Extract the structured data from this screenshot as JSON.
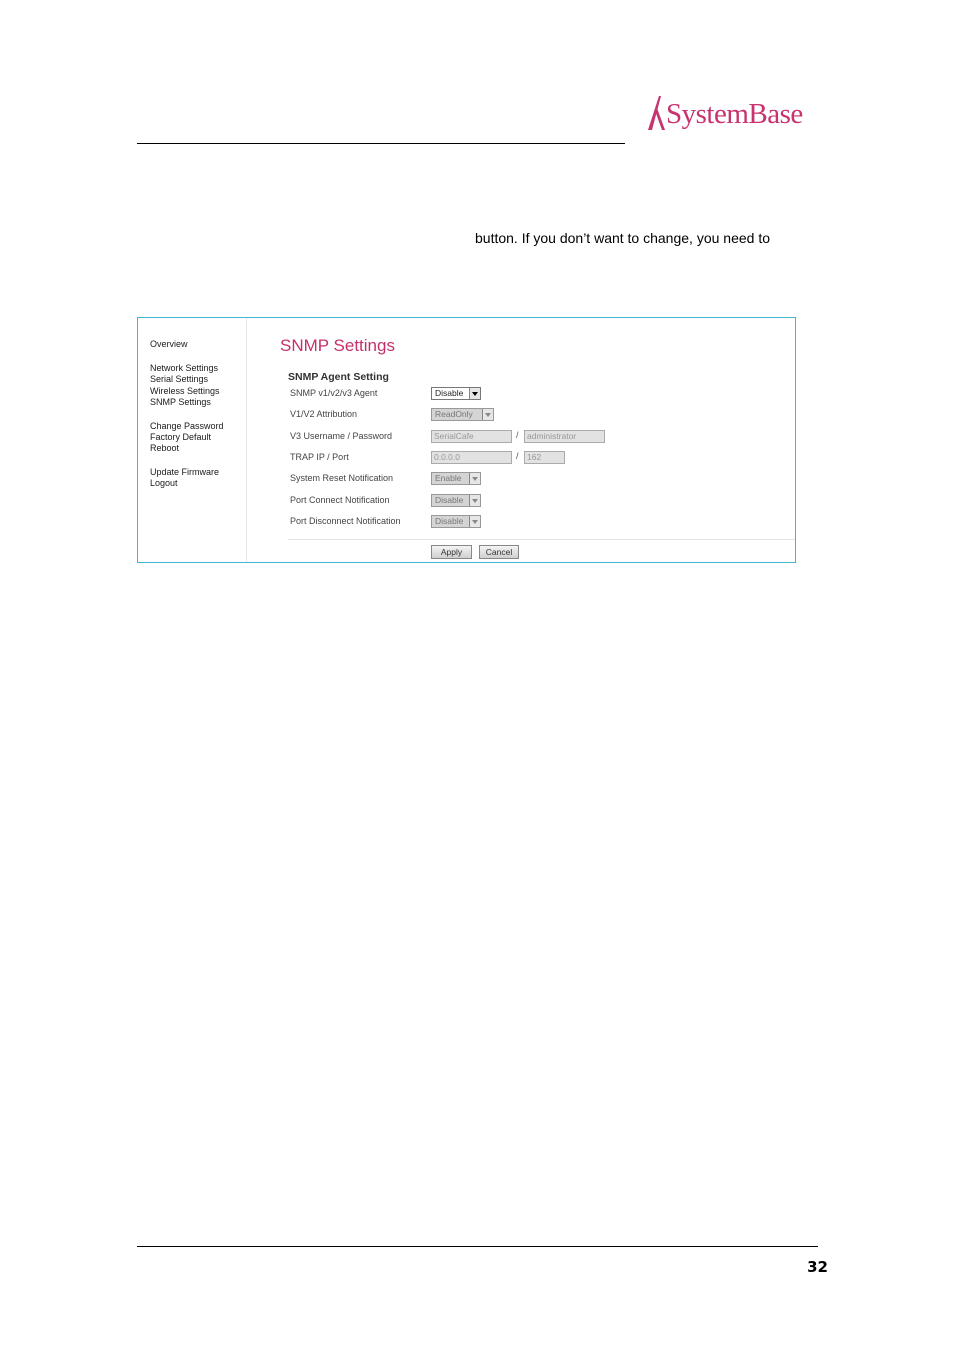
{
  "brand": {
    "name": "SystemBase",
    "color": "#c8326e"
  },
  "page_number": "32",
  "body_text": "button. If you don’t want to change, you need to",
  "menu": {
    "items": [
      "Overview",
      "Network Settings",
      "Serial Settings",
      "Wireless Settings",
      "SNMP Settings",
      "Change Password",
      "Factory Default",
      "Reboot",
      "Update Firmware",
      "Logout"
    ]
  },
  "panel": {
    "title": "SNMP Settings",
    "section": "SNMP Agent Setting",
    "agent": {
      "label": "SNMP v1/v2/v3 Agent",
      "value": "Disable"
    },
    "attribution": {
      "label": "V1/V2 Attribution",
      "value": "ReadOnly"
    },
    "v3": {
      "label": "V3 Username / Password",
      "username": "SerialCafe",
      "separator": "/",
      "password": "administrator"
    },
    "trap": {
      "label": "TRAP IP / Port",
      "ip": "0.0.0.0",
      "separator": "/",
      "port": "162"
    },
    "reset_notification": {
      "label": "System Reset Notification",
      "value": "Enable"
    },
    "connect_notification": {
      "label": "Port Connect Notification",
      "value": "Disable"
    },
    "disconnect_notification": {
      "label": "Port Disconnect Notification",
      "value": "Disable"
    },
    "apply": "Apply",
    "cancel": "Cancel"
  },
  "colors": {
    "accent_title": "#c5306b",
    "frame_border": "#41b6d0"
  }
}
